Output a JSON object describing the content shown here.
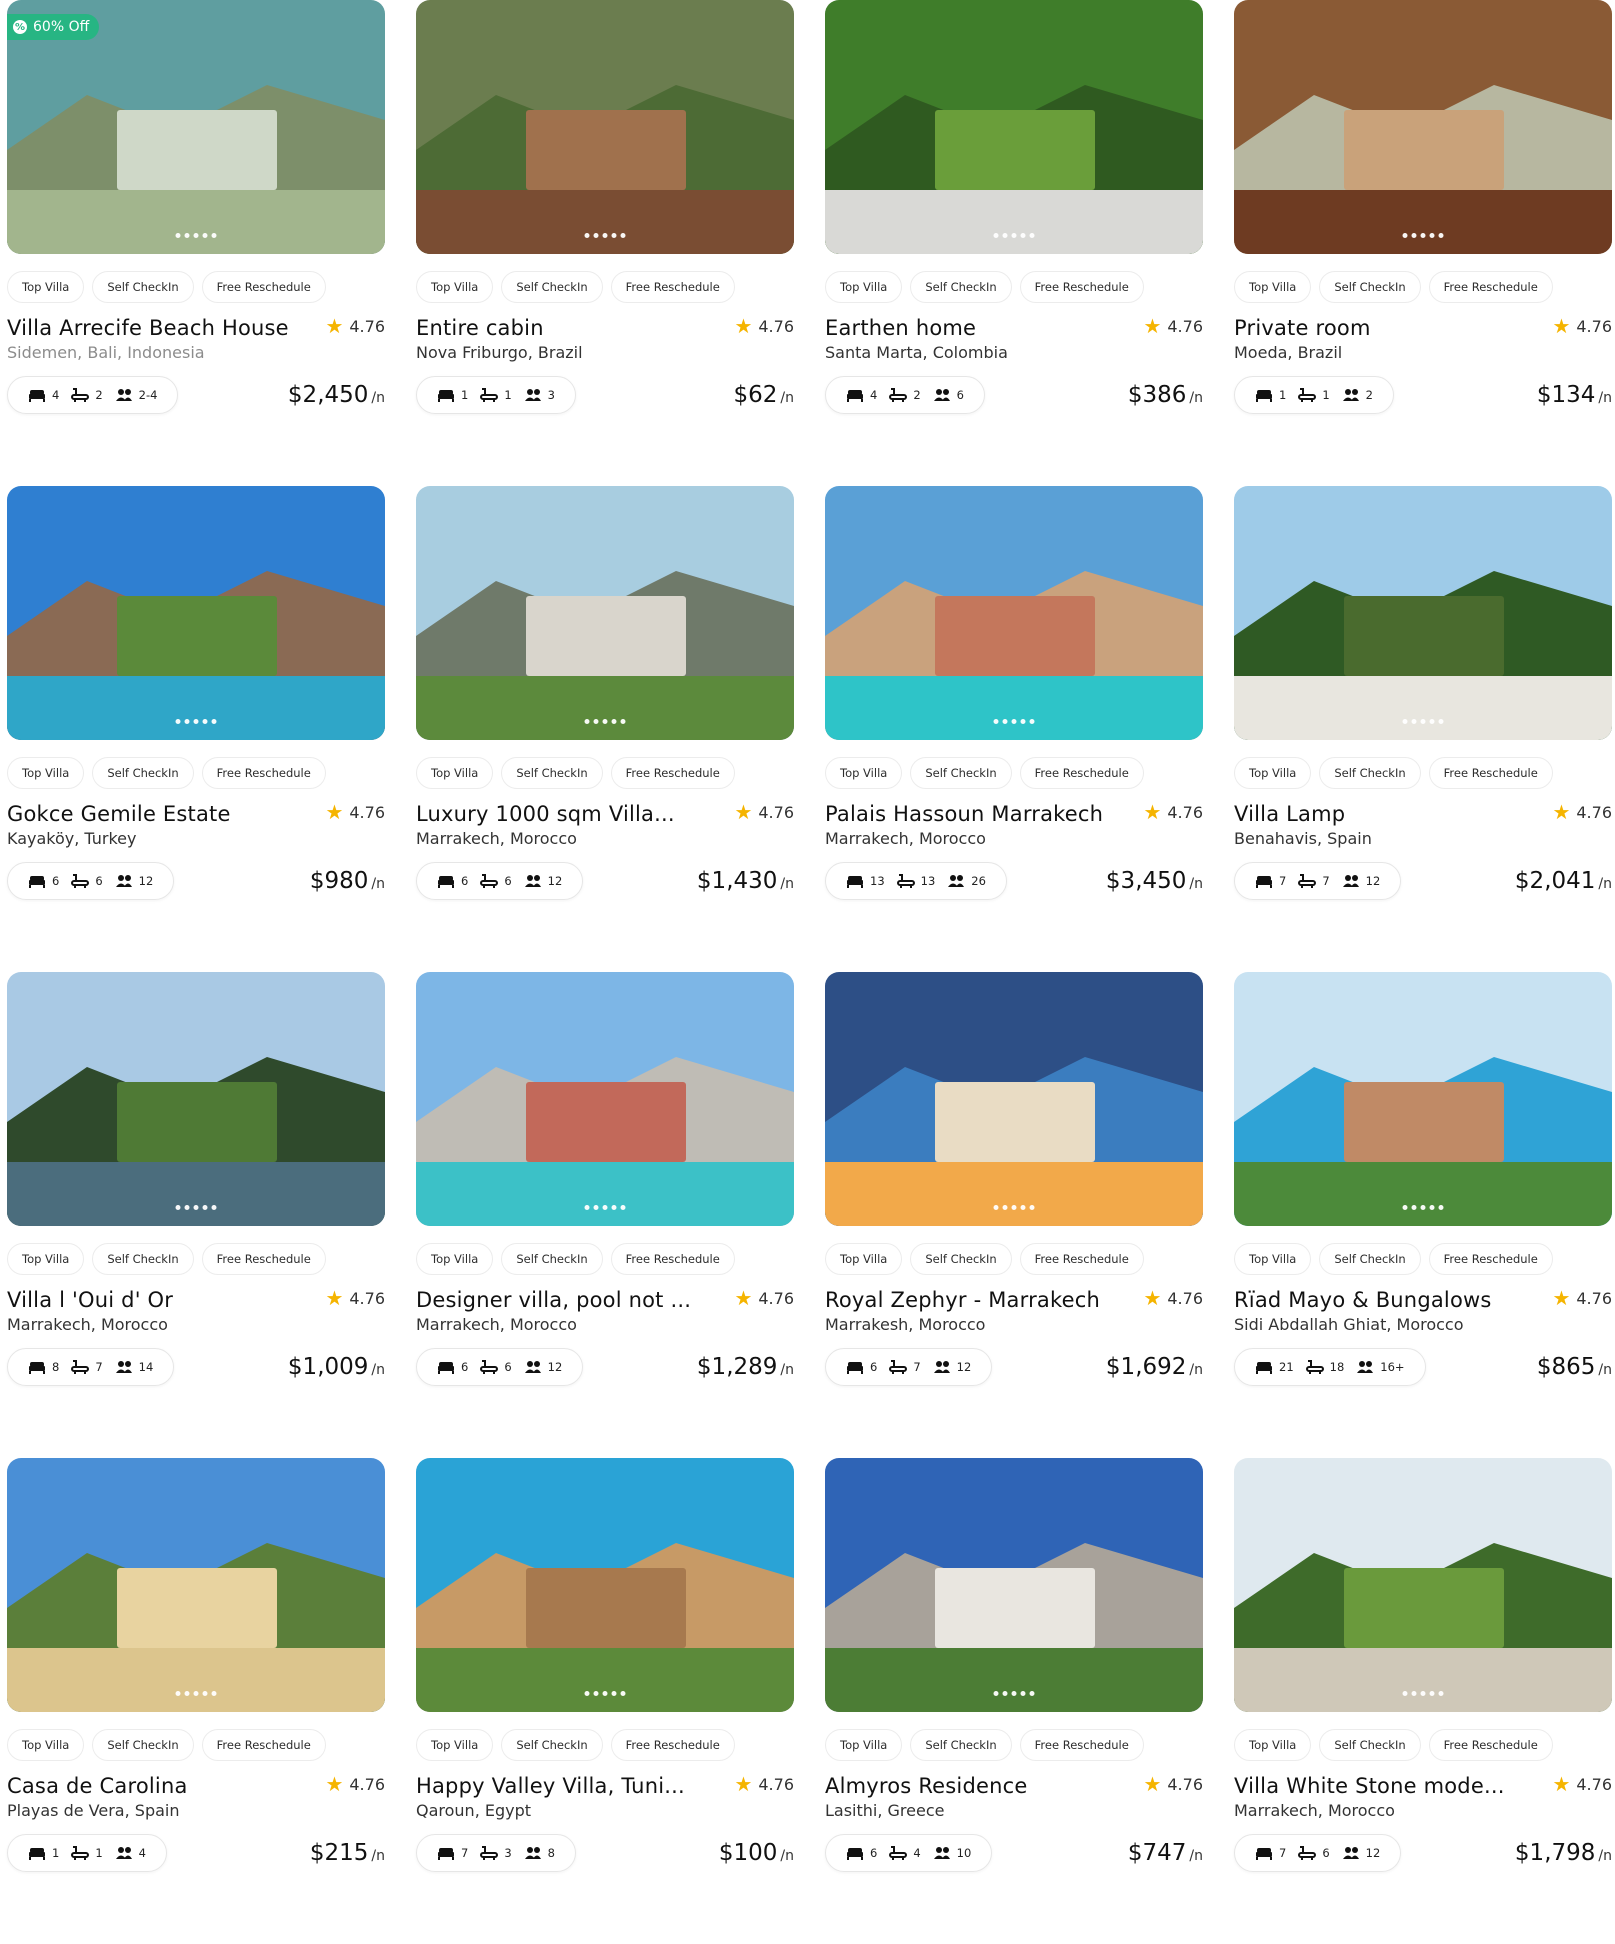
{
  "tags": [
    "Top Villa",
    "Self CheckIn",
    "Free Reschedule"
  ],
  "price_unit": "/n",
  "colors": {
    "accent": "#27b583",
    "star": "#f5b400"
  },
  "icons": {
    "bed": "bed-icon",
    "bath": "bath-icon",
    "guests": "guests-icon",
    "rating": "star-icon",
    "badge": "discount-icon"
  },
  "listings": [
    {
      "title": "Villa Arrecife Beach House",
      "location": "Sidemen, Bali, Indonesia",
      "location_muted": true,
      "rating": "4.76",
      "beds": "4",
      "baths": "2",
      "guests": "2-4",
      "price": "$2,450",
      "discount": "60% Off",
      "photo": [
        "#5f9ea0",
        "#cfd8c8",
        "#a2b58d",
        "#7d8f6a"
      ]
    },
    {
      "title": "Entire cabin",
      "location": "Nova Friburgo, Brazil",
      "rating": "4.76",
      "beds": "1",
      "baths": "1",
      "guests": "3",
      "price": "$62",
      "photo": [
        "#6b7d4f",
        "#a0714d",
        "#7a4d33",
        "#4d6b35"
      ]
    },
    {
      "title": "Earthen home",
      "location": "Santa Marta, Colombia",
      "rating": "4.76",
      "beds": "4",
      "baths": "2",
      "guests": "6",
      "price": "$386",
      "photo": [
        "#3f7d2a",
        "#6a9e3a",
        "#d9d9d6",
        "#2f5a20"
      ]
    },
    {
      "title": "Private room",
      "location": "Moeda, Brazil",
      "rating": "4.76",
      "beds": "1",
      "baths": "1",
      "guests": "2",
      "price": "$134",
      "photo": [
        "#8a5a35",
        "#c9a27a",
        "#6e3b22",
        "#b7b7a0"
      ]
    },
    {
      "title": "Gokce Gemile Estate",
      "location": "Kayaköy, Turkey",
      "rating": "4.76",
      "beds": "6",
      "baths": "6",
      "guests": "12",
      "price": "$980",
      "photo": [
        "#2f7fd1",
        "#5b8a3a",
        "#2fa6c8",
        "#8a6a54"
      ]
    },
    {
      "title": "Luxury 1000 sqm Villa...",
      "location": "Marrakech, Morocco",
      "rating": "4.76",
      "beds": "6",
      "baths": "6",
      "guests": "12",
      "price": "$1,430",
      "photo": [
        "#a8cde0",
        "#d9d5cc",
        "#5c8a3c",
        "#6f7a6a"
      ]
    },
    {
      "title": "Palais Hassoun Marrakech",
      "location": "Marrakech, Morocco",
      "rating": "4.76",
      "beds": "13",
      "baths": "13",
      "guests": "26",
      "price": "$3,450",
      "photo": [
        "#5aa0d6",
        "#c4775c",
        "#2ec4c8",
        "#c9a27d"
      ]
    },
    {
      "title": "Villa Lamp",
      "location": "Benahavis, Spain",
      "rating": "4.76",
      "beds": "7",
      "baths": "7",
      "guests": "12",
      "price": "$2,041",
      "photo": [
        "#9ecbe8",
        "#4a6b2e",
        "#e8e6df",
        "#2f5a24"
      ]
    },
    {
      "title": "Villa l 'Oui d' Or",
      "location": "Marrakech, Morocco",
      "rating": "4.76",
      "beds": "8",
      "baths": "7",
      "guests": "14",
      "price": "$1,009",
      "photo": [
        "#a9c9e4",
        "#4f7a35",
        "#4b6d7d",
        "#2f4a2c"
      ]
    },
    {
      "title": "Designer villa, pool not ...",
      "location": "Marrakech, Morocco",
      "rating": "4.76",
      "beds": "6",
      "baths": "6",
      "guests": "12",
      "price": "$1,289",
      "photo": [
        "#7db6e6",
        "#c2695a",
        "#3cc1c7",
        "#bfbcb5"
      ]
    },
    {
      "title": "Royal Zephyr - Marrakech",
      "location": "Marrakesh, Morocco",
      "rating": "4.76",
      "beds": "6",
      "baths": "7",
      "guests": "12",
      "price": "$1,692",
      "photo": [
        "#2d4f86",
        "#e9dcc4",
        "#f2a94a",
        "#3b7dbf"
      ]
    },
    {
      "title": "Rïad Mayo & Bungalows",
      "location": "Sidi Abdallah Ghiat, Morocco",
      "rating": "4.76",
      "beds": "21",
      "baths": "18",
      "guests": "16+",
      "price": "$865",
      "photo": [
        "#c8e2f2",
        "#c08a66",
        "#4c8a3a",
        "#2fa3d6"
      ]
    },
    {
      "title": "Casa de Carolina",
      "location": "Playas de Vera, Spain",
      "rating": "4.76",
      "beds": "1",
      "baths": "1",
      "guests": "4",
      "price": "$215",
      "photo": [
        "#4a8fd6",
        "#e8d3a0",
        "#dcc58d",
        "#5b7f3a"
      ]
    },
    {
      "title": "Happy Valley Villa, Tuni...",
      "location": "Qaroun, Egypt",
      "rating": "4.76",
      "beds": "7",
      "baths": "3",
      "guests": "8",
      "price": "$100",
      "photo": [
        "#2aa3d6",
        "#a7794e",
        "#5c8a3a",
        "#c79a66"
      ]
    },
    {
      "title": "Almyros Residence",
      "location": "Lasithi, Greece",
      "rating": "4.76",
      "beds": "6",
      "baths": "4",
      "guests": "10",
      "price": "$747",
      "photo": [
        "#2f64b6",
        "#e9e6e0",
        "#4c7d35",
        "#a8a29a"
      ]
    },
    {
      "title": "Villa White Stone mode...",
      "location": "Marrakech, Morocco",
      "rating": "4.76",
      "beds": "7",
      "baths": "6",
      "guests": "12",
      "price": "$1,798",
      "photo": [
        "#dfe9ef",
        "#6a9a3c",
        "#cfc8b8",
        "#3e6b2a"
      ]
    }
  ]
}
